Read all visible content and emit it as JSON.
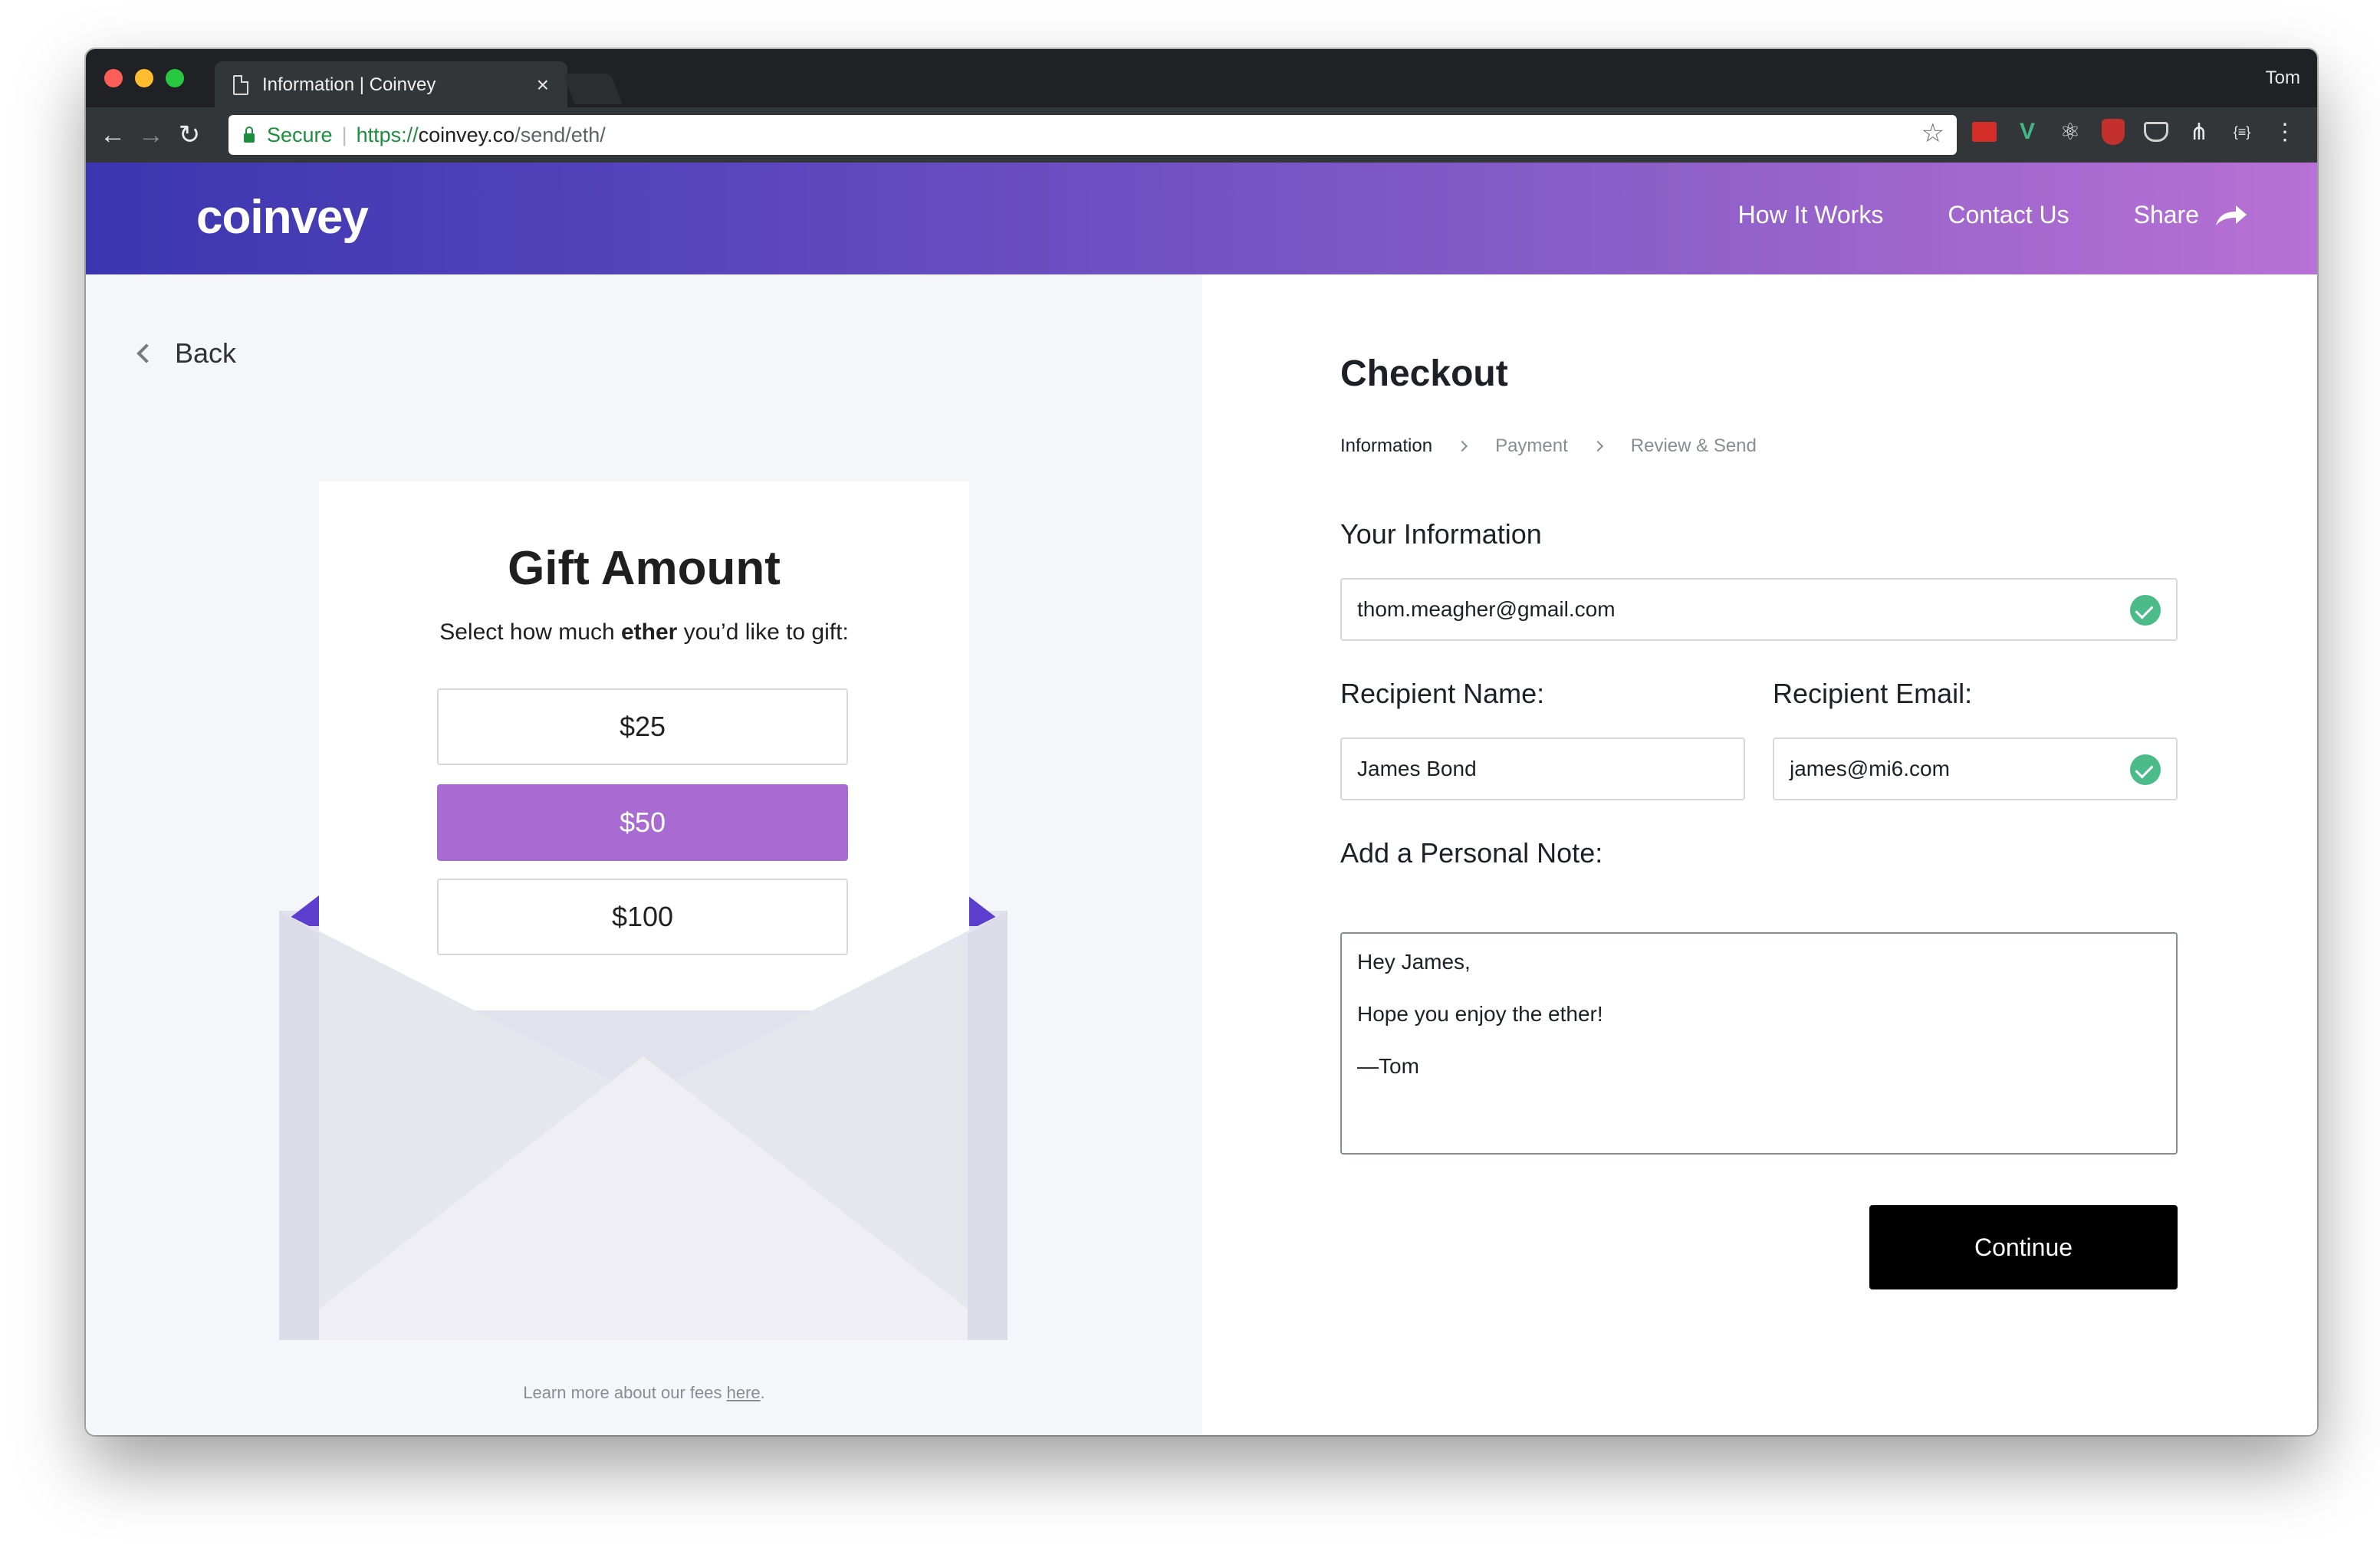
{
  "browser": {
    "tab_title": "Information | Coinvey",
    "profile_name": "Tom",
    "secure_label": "Secure",
    "url_scheme": "https://",
    "url_host": "coinvey.co",
    "url_path": "/send/eth/"
  },
  "site": {
    "logo": "coinvey",
    "nav": {
      "how_it_works": "How It Works",
      "contact_us": "Contact Us",
      "share": "Share"
    },
    "colors": {
      "header_start": "#3b36b0",
      "header_end": "#b871d4",
      "accent": "#a76bd1",
      "success": "#4cbb8a"
    }
  },
  "left": {
    "back_label": "Back",
    "gift_title": "Gift Amount",
    "gift_sub_pre": "Select how much ",
    "gift_sub_bold": "ether",
    "gift_sub_post": " you’d like to gift:",
    "amounts": [
      "$25",
      "$50",
      "$100"
    ],
    "selected_amount": "$50",
    "fees_pre": "Learn more about our fees ",
    "fees_link": "here",
    "fees_post": "."
  },
  "checkout": {
    "title": "Checkout",
    "steps": [
      "Information",
      "Payment",
      "Review & Send"
    ],
    "your_info_label": "Your Information",
    "email_value": "thom.meagher@gmail.com",
    "recipient_name_label": "Recipient Name:",
    "recipient_name_value": "James Bond",
    "recipient_email_label": "Recipient Email:",
    "recipient_email_value": "james@mi6.com",
    "note_label": "Add a Personal Note:",
    "note_lines": [
      "Hey James,",
      "Hope you enjoy the ether!",
      "—Tom"
    ],
    "continue_label": "Continue"
  }
}
